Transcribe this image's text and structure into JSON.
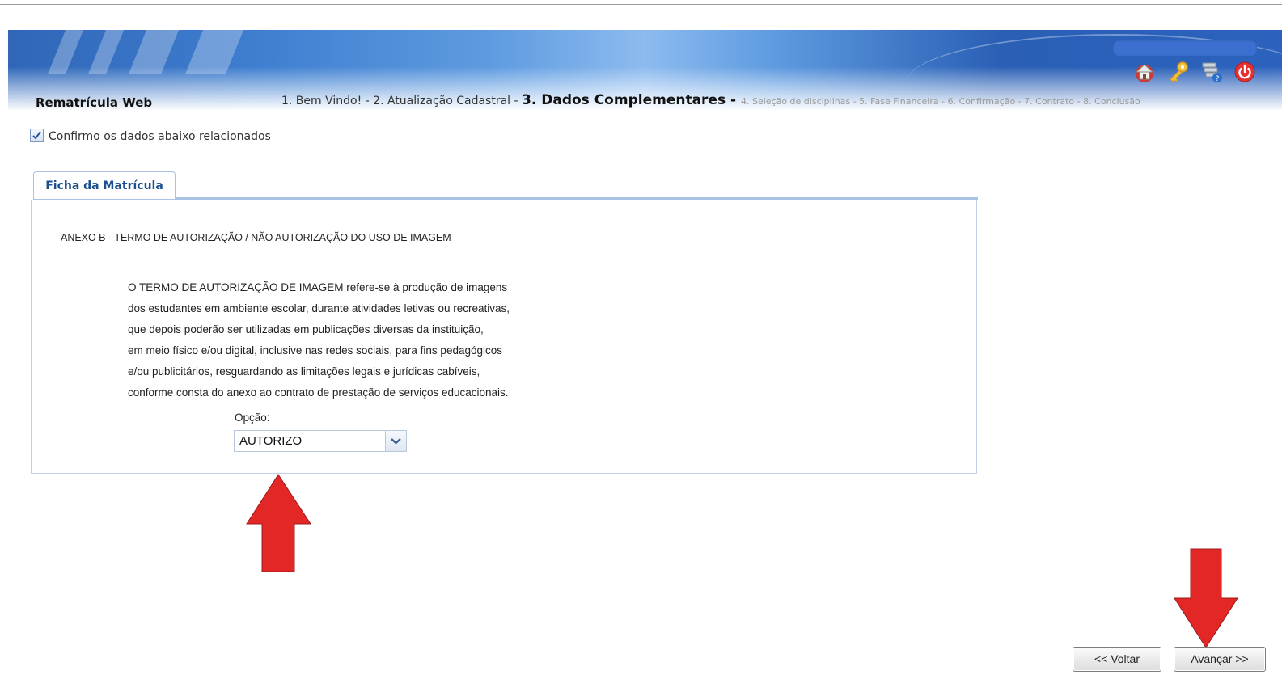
{
  "header": {
    "app_title": "Rematrícula Web",
    "icons": [
      "home-icon",
      "key-icon",
      "help-icon",
      "logout-icon"
    ]
  },
  "steps": {
    "done": "1. Bem Vindo! - 2. Atualização Cadastral - ",
    "current": "3. Dados Complementares - ",
    "upcoming": "4. Seleção de disciplinas - 5. Fase Financeira - 6. Confirmação - 7. Contrato - 8. Conclusão"
  },
  "confirm": {
    "label": "Confirmo os dados abaixo relacionados",
    "checked": true
  },
  "tab": {
    "label": "Ficha da Matrícula"
  },
  "annex": {
    "title": "ANEXO B - TERMO DE AUTORIZAÇÃO / NÃO AUTORIZAÇÃO DO USO DE IMAGEM",
    "lines": [
      "O TERMO DE AUTORIZAÇÃO DE IMAGEM refere-se à produção de imagens",
      "dos estudantes em ambiente escolar, durante atividades letivas ou recreativas,",
      "que depois poderão ser utilizadas em publicações diversas da instituição,",
      "em meio físico e/ou digital, inclusive nas redes sociais, para fins pedagógicos",
      "e/ou publicitários, resguardando as limitações legais e jurídicas cabíveis,",
      "conforme consta do anexo ao contrato de prestação de serviços educacionais."
    ],
    "option_label": "Opção:",
    "option_value": "AUTORIZO"
  },
  "buttons": {
    "back": "<< Voltar",
    "next": "Avançar >>"
  },
  "colors": {
    "arrow": "#e32626",
    "tab_text": "#1c4f8e",
    "banner": "#3f7fd0"
  }
}
